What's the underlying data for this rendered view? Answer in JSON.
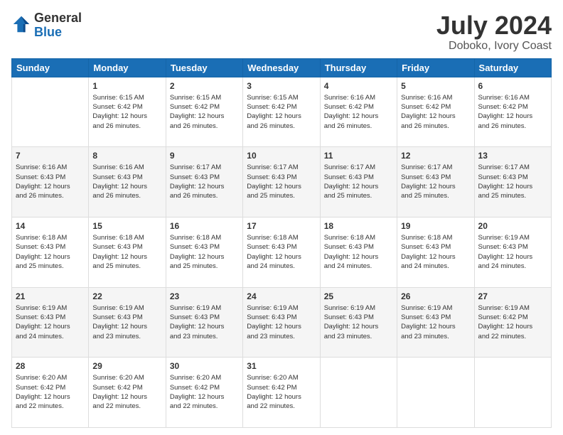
{
  "header": {
    "logo_general": "General",
    "logo_blue": "Blue",
    "month_title": "July 2024",
    "location": "Doboko, Ivory Coast"
  },
  "days_of_week": [
    "Sunday",
    "Monday",
    "Tuesday",
    "Wednesday",
    "Thursday",
    "Friday",
    "Saturday"
  ],
  "weeks": [
    [
      {
        "day": "",
        "info": ""
      },
      {
        "day": "1",
        "info": "Sunrise: 6:15 AM\nSunset: 6:42 PM\nDaylight: 12 hours\nand 26 minutes."
      },
      {
        "day": "2",
        "info": "Sunrise: 6:15 AM\nSunset: 6:42 PM\nDaylight: 12 hours\nand 26 minutes."
      },
      {
        "day": "3",
        "info": "Sunrise: 6:15 AM\nSunset: 6:42 PM\nDaylight: 12 hours\nand 26 minutes."
      },
      {
        "day": "4",
        "info": "Sunrise: 6:16 AM\nSunset: 6:42 PM\nDaylight: 12 hours\nand 26 minutes."
      },
      {
        "day": "5",
        "info": "Sunrise: 6:16 AM\nSunset: 6:42 PM\nDaylight: 12 hours\nand 26 minutes."
      },
      {
        "day": "6",
        "info": "Sunrise: 6:16 AM\nSunset: 6:42 PM\nDaylight: 12 hours\nand 26 minutes."
      }
    ],
    [
      {
        "day": "7",
        "info": "Sunrise: 6:16 AM\nSunset: 6:43 PM\nDaylight: 12 hours\nand 26 minutes."
      },
      {
        "day": "8",
        "info": "Sunrise: 6:16 AM\nSunset: 6:43 PM\nDaylight: 12 hours\nand 26 minutes."
      },
      {
        "day": "9",
        "info": "Sunrise: 6:17 AM\nSunset: 6:43 PM\nDaylight: 12 hours\nand 26 minutes."
      },
      {
        "day": "10",
        "info": "Sunrise: 6:17 AM\nSunset: 6:43 PM\nDaylight: 12 hours\nand 25 minutes."
      },
      {
        "day": "11",
        "info": "Sunrise: 6:17 AM\nSunset: 6:43 PM\nDaylight: 12 hours\nand 25 minutes."
      },
      {
        "day": "12",
        "info": "Sunrise: 6:17 AM\nSunset: 6:43 PM\nDaylight: 12 hours\nand 25 minutes."
      },
      {
        "day": "13",
        "info": "Sunrise: 6:17 AM\nSunset: 6:43 PM\nDaylight: 12 hours\nand 25 minutes."
      }
    ],
    [
      {
        "day": "14",
        "info": "Sunrise: 6:18 AM\nSunset: 6:43 PM\nDaylight: 12 hours\nand 25 minutes."
      },
      {
        "day": "15",
        "info": "Sunrise: 6:18 AM\nSunset: 6:43 PM\nDaylight: 12 hours\nand 25 minutes."
      },
      {
        "day": "16",
        "info": "Sunrise: 6:18 AM\nSunset: 6:43 PM\nDaylight: 12 hours\nand 25 minutes."
      },
      {
        "day": "17",
        "info": "Sunrise: 6:18 AM\nSunset: 6:43 PM\nDaylight: 12 hours\nand 24 minutes."
      },
      {
        "day": "18",
        "info": "Sunrise: 6:18 AM\nSunset: 6:43 PM\nDaylight: 12 hours\nand 24 minutes."
      },
      {
        "day": "19",
        "info": "Sunrise: 6:18 AM\nSunset: 6:43 PM\nDaylight: 12 hours\nand 24 minutes."
      },
      {
        "day": "20",
        "info": "Sunrise: 6:19 AM\nSunset: 6:43 PM\nDaylight: 12 hours\nand 24 minutes."
      }
    ],
    [
      {
        "day": "21",
        "info": "Sunrise: 6:19 AM\nSunset: 6:43 PM\nDaylight: 12 hours\nand 24 minutes."
      },
      {
        "day": "22",
        "info": "Sunrise: 6:19 AM\nSunset: 6:43 PM\nDaylight: 12 hours\nand 23 minutes."
      },
      {
        "day": "23",
        "info": "Sunrise: 6:19 AM\nSunset: 6:43 PM\nDaylight: 12 hours\nand 23 minutes."
      },
      {
        "day": "24",
        "info": "Sunrise: 6:19 AM\nSunset: 6:43 PM\nDaylight: 12 hours\nand 23 minutes."
      },
      {
        "day": "25",
        "info": "Sunrise: 6:19 AM\nSunset: 6:43 PM\nDaylight: 12 hours\nand 23 minutes."
      },
      {
        "day": "26",
        "info": "Sunrise: 6:19 AM\nSunset: 6:43 PM\nDaylight: 12 hours\nand 23 minutes."
      },
      {
        "day": "27",
        "info": "Sunrise: 6:19 AM\nSunset: 6:42 PM\nDaylight: 12 hours\nand 22 minutes."
      }
    ],
    [
      {
        "day": "28",
        "info": "Sunrise: 6:20 AM\nSunset: 6:42 PM\nDaylight: 12 hours\nand 22 minutes."
      },
      {
        "day": "29",
        "info": "Sunrise: 6:20 AM\nSunset: 6:42 PM\nDaylight: 12 hours\nand 22 minutes."
      },
      {
        "day": "30",
        "info": "Sunrise: 6:20 AM\nSunset: 6:42 PM\nDaylight: 12 hours\nand 22 minutes."
      },
      {
        "day": "31",
        "info": "Sunrise: 6:20 AM\nSunset: 6:42 PM\nDaylight: 12 hours\nand 22 minutes."
      },
      {
        "day": "",
        "info": ""
      },
      {
        "day": "",
        "info": ""
      },
      {
        "day": "",
        "info": ""
      }
    ]
  ]
}
